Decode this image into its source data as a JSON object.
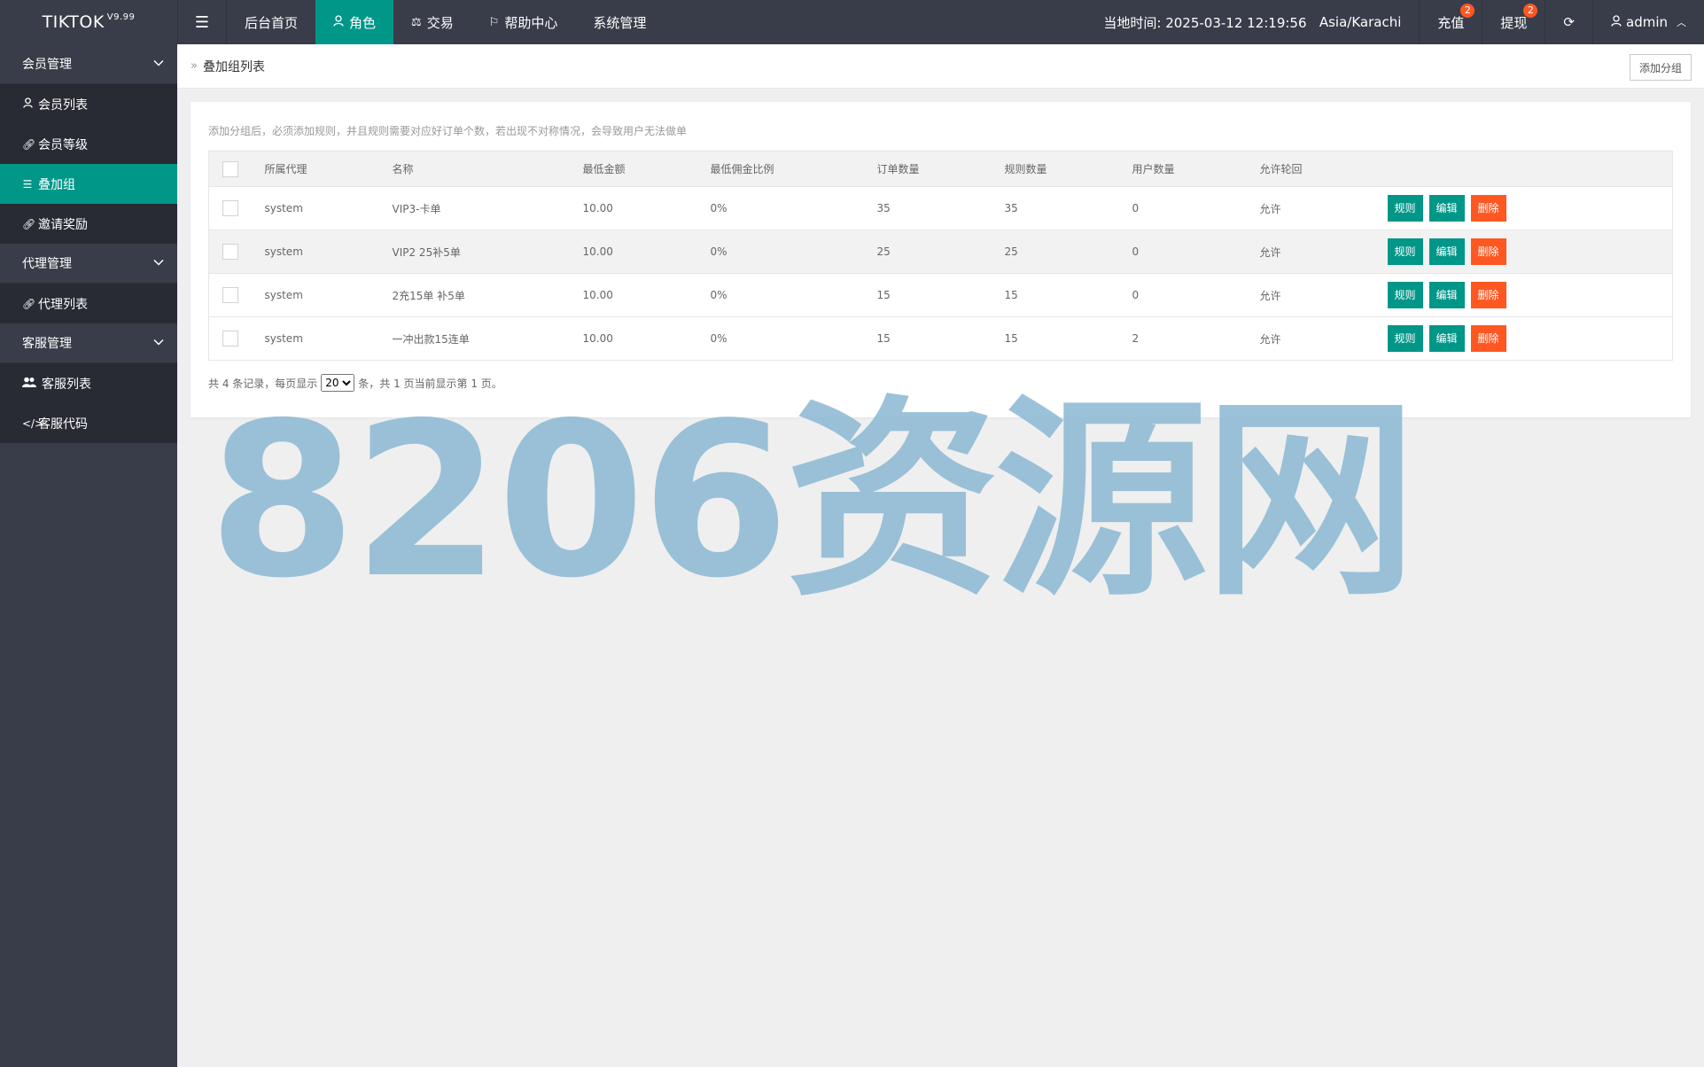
{
  "app": {
    "logo": "TIKTOK",
    "version": "V9.99"
  },
  "topnav": {
    "toggle_icon": "menu-icon",
    "items": [
      {
        "label": "后台首页",
        "icon": ""
      },
      {
        "label": "角色",
        "icon": "user-icon",
        "active": true
      },
      {
        "label": "交易",
        "icon": "scale-icon"
      },
      {
        "label": "帮助中心",
        "icon": "flag-icon"
      },
      {
        "label": "系统管理",
        "icon": ""
      }
    ]
  },
  "topright": {
    "time_label": "当地时间: 2025-03-12 12:19:56",
    "timezone": "Asia/Karachi",
    "recharge": {
      "label": "充值",
      "badge": "2"
    },
    "withdraw": {
      "label": "提现",
      "badge": "2"
    },
    "refresh_icon": "refresh-icon",
    "user": "admin"
  },
  "sidebar": {
    "groups": [
      {
        "label": "会员管理",
        "items": [
          {
            "label": "会员列表",
            "icon": "user-icon"
          },
          {
            "label": "会员等级",
            "icon": "link-icon"
          },
          {
            "label": "叠加组",
            "icon": "list-icon",
            "active": true
          },
          {
            "label": "邀请奖励",
            "icon": "link-icon"
          }
        ]
      },
      {
        "label": "代理管理",
        "items": [
          {
            "label": "代理列表",
            "icon": "link-icon"
          }
        ]
      },
      {
        "label": "客服管理",
        "items": [
          {
            "label": "客服列表",
            "icon": "users-icon"
          },
          {
            "label": "客服代码",
            "icon": "code-icon"
          }
        ]
      }
    ]
  },
  "breadcrumb": {
    "label": "叠加组列表",
    "add_button": "添加分组"
  },
  "tip": "添加分组后，必须添加规则，并且规则需要对应好订单个数，若出现不对称情况，会导致用户无法做单",
  "table": {
    "headers": [
      "所属代理",
      "名称",
      "最低金额",
      "最低佣金比例",
      "订单数量",
      "规则数量",
      "用户数量",
      "允许轮回"
    ],
    "rows": [
      [
        "system",
        "VIP3-卡单",
        "10.00",
        "0%",
        "35",
        "35",
        "0",
        "允许"
      ],
      [
        "system",
        "VIP2 25补5单",
        "10.00",
        "0%",
        "25",
        "25",
        "0",
        "允许"
      ],
      [
        "system",
        "2充15单 补5单",
        "10.00",
        "0%",
        "15",
        "15",
        "0",
        "允许"
      ],
      [
        "system",
        "一冲出款15连单",
        "10.00",
        "0%",
        "15",
        "15",
        "2",
        "允许"
      ]
    ],
    "actions": {
      "rule": "规则",
      "edit": "编辑",
      "delete": "删除"
    }
  },
  "pager": {
    "prefix": "共 4 条记录，每页显示",
    "page_size": "20",
    "suffix": "条，共 1 页当前显示第 1 页。"
  },
  "watermark": "8206资源网"
}
